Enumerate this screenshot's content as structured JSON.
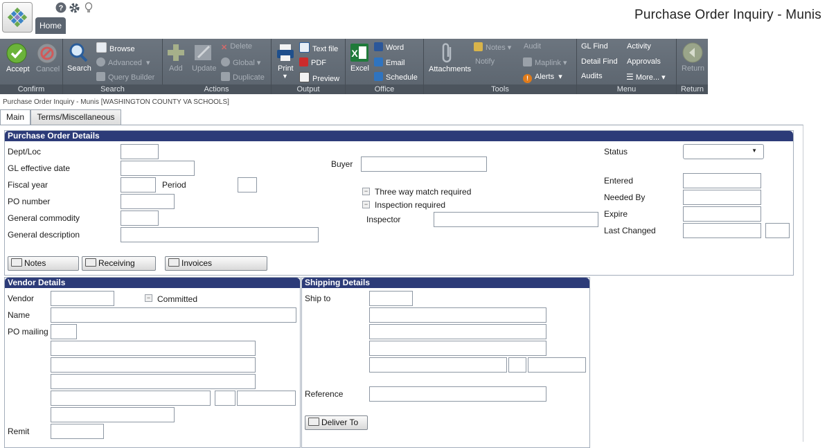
{
  "app": {
    "title": "Purchase Order Inquiry - Munis",
    "home_tab": "Home",
    "breadcrumb": "Purchase Order Inquiry - Munis [WASHINGTON COUNTY VA SCHOOLS]"
  },
  "ribbon": {
    "confirm": {
      "caption": "Confirm",
      "accept": "Accept",
      "cancel": "Cancel"
    },
    "search": {
      "caption": "Search",
      "search": "Search",
      "browse": "Browse",
      "advanced": "Advanced",
      "query_builder": "Query Builder"
    },
    "actions": {
      "caption": "Actions",
      "add": "Add",
      "update": "Update",
      "delete": "Delete",
      "global": "Global",
      "duplicate": "Duplicate"
    },
    "output": {
      "caption": "Output",
      "print": "Print",
      "text_file": "Text file",
      "pdf": "PDF",
      "preview": "Preview"
    },
    "office": {
      "caption": "Office",
      "excel": "Excel",
      "word": "Word",
      "email": "Email",
      "schedule": "Schedule"
    },
    "tools": {
      "caption": "Tools",
      "attachments": "Attachments",
      "notes": "Notes",
      "notify": "Notify",
      "audit": "Audit",
      "maplink": "Maplink",
      "alerts": "Alerts"
    },
    "menu": {
      "caption": "Menu",
      "gl_find": "GL Find",
      "detail_find": "Detail Find",
      "audits": "Audits",
      "activity": "Activity",
      "approvals": "Approvals",
      "more": "More..."
    },
    "return": {
      "caption": "Return",
      "return": "Return"
    }
  },
  "tabs": {
    "main": "Main",
    "terms": "Terms/Miscellaneous"
  },
  "po_details": {
    "heading": "Purchase Order Details",
    "dept_loc": "Dept/Loc",
    "gl_effective_date": "GL effective date",
    "fiscal_year": "Fiscal year",
    "period": "Period",
    "po_number": "PO number",
    "general_commodity": "General commodity",
    "general_description": "General description",
    "buyer": "Buyer",
    "three_way_match": "Three way match required",
    "inspection_required": "Inspection required",
    "inspector": "Inspector",
    "status": "Status",
    "entered": "Entered",
    "needed_by": "Needed By",
    "expire": "Expire",
    "last_changed": "Last Changed",
    "btn_notes": "Notes",
    "btn_receiving": "Receiving",
    "btn_invoices": "Invoices"
  },
  "vendor": {
    "heading": "Vendor Details",
    "vendor": "Vendor",
    "committed": "Committed",
    "name": "Name",
    "po_mailing": "PO mailing",
    "remit": "Remit"
  },
  "shipping": {
    "heading": "Shipping Details",
    "ship_to": "Ship to",
    "reference": "Reference",
    "deliver_to": "Deliver To"
  }
}
